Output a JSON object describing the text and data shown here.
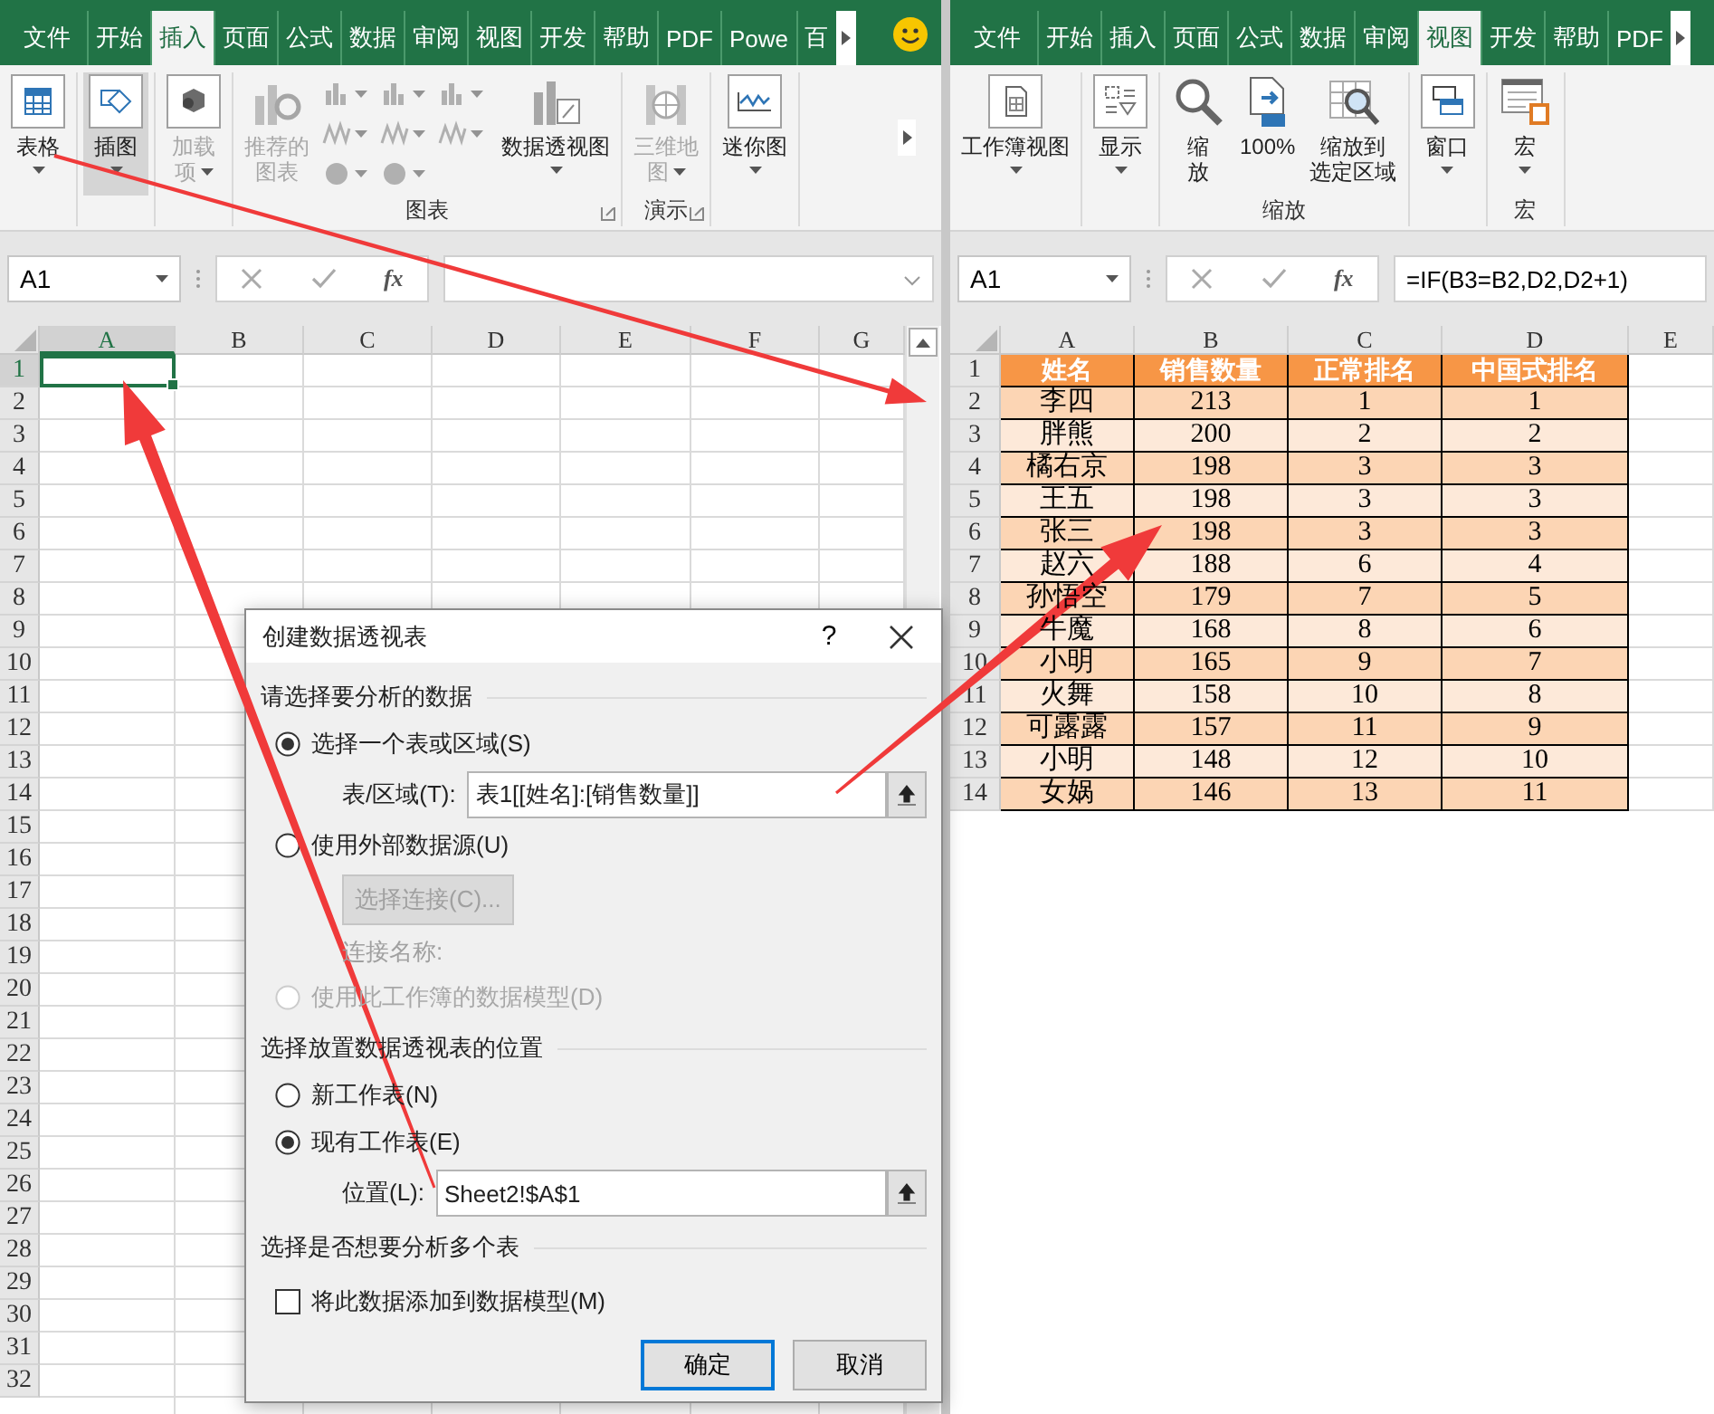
{
  "left_pane": {
    "tabs": [
      {
        "label": "文件",
        "selected": false
      },
      {
        "label": "开始",
        "selected": false
      },
      {
        "label": "插入",
        "selected": true
      },
      {
        "label": "页面",
        "selected": false
      },
      {
        "label": "公式",
        "selected": false
      },
      {
        "label": "数据",
        "selected": false
      },
      {
        "label": "审阅",
        "selected": false
      },
      {
        "label": "视图",
        "selected": false
      },
      {
        "label": "开发",
        "selected": false
      },
      {
        "label": "帮助",
        "selected": false
      },
      {
        "label": "PDF",
        "selected": false
      },
      {
        "label": "Powe",
        "selected": false
      },
      {
        "label": "百",
        "selected": false
      }
    ],
    "ribbon": {
      "groups": [
        {
          "items": [
            {
              "kind": "big",
              "lines": [
                "表格"
              ],
              "dropdown": true,
              "disabled": false,
              "pressed": false
            }
          ]
        },
        {
          "items": [
            {
              "kind": "big",
              "lines": [
                "插图"
              ],
              "dropdown": true,
              "disabled": false,
              "pressed": true
            }
          ]
        },
        {
          "items": [
            {
              "kind": "big",
              "lines": [
                "加载",
                "项"
              ],
              "dropdown": true,
              "disabled": true,
              "pressed": false
            }
          ]
        },
        {
          "label": "图表",
          "items": [
            {
              "kind": "big",
              "lines": [
                "推荐的",
                "图表"
              ],
              "dropdown": false,
              "disabled": true,
              "pressed": false
            },
            {
              "kind": "gallery",
              "dropdown": true,
              "disabled": true,
              "pressed": false
            },
            {
              "kind": "big",
              "lines": [
                "数据透视图"
              ],
              "dropdown": true,
              "disabled": false,
              "pressed": false
            }
          ]
        },
        {
          "label": "演示",
          "items": [
            {
              "kind": "big",
              "lines": [
                "三维地",
                "图"
              ],
              "dropdown": true,
              "disabled": true,
              "pressed": false
            }
          ]
        },
        {
          "items": [
            {
              "kind": "big",
              "lines": [
                "迷你图"
              ],
              "dropdown": true,
              "disabled": false,
              "pressed": false
            }
          ]
        }
      ]
    },
    "formula_bar": {
      "name_box": "A1",
      "function_label": "fx"
    },
    "grid": {
      "columns": [
        {
          "label": "A",
          "selected": true
        },
        {
          "label": "B",
          "selected": false
        },
        {
          "label": "C",
          "selected": false
        },
        {
          "label": "D",
          "selected": false
        },
        {
          "label": "E",
          "selected": false
        },
        {
          "label": "F",
          "selected": false
        },
        {
          "label": "G",
          "selected": false
        }
      ],
      "rows": [
        {
          "label": "1",
          "selected": true
        },
        {
          "label": "2",
          "selected": false
        },
        {
          "label": "3",
          "selected": false
        },
        {
          "label": "4",
          "selected": false
        },
        {
          "label": "5",
          "selected": false
        },
        {
          "label": "6",
          "selected": false
        },
        {
          "label": "7",
          "selected": false
        },
        {
          "label": "8",
          "selected": false
        },
        {
          "label": "9",
          "selected": false
        },
        {
          "label": "10",
          "selected": false
        },
        {
          "label": "11",
          "selected": false
        },
        {
          "label": "12",
          "selected": false
        },
        {
          "label": "13",
          "selected": false
        },
        {
          "label": "14",
          "selected": false
        },
        {
          "label": "15",
          "selected": false
        },
        {
          "label": "16",
          "selected": false
        },
        {
          "label": "17",
          "selected": false
        },
        {
          "label": "18",
          "selected": false
        },
        {
          "label": "19",
          "selected": false
        },
        {
          "label": "20",
          "selected": false
        },
        {
          "label": "21",
          "selected": false
        },
        {
          "label": "22",
          "selected": false
        },
        {
          "label": "23",
          "selected": false
        },
        {
          "label": "24",
          "selected": false
        },
        {
          "label": "25",
          "selected": false
        },
        {
          "label": "26",
          "selected": false
        },
        {
          "label": "27",
          "selected": false
        },
        {
          "label": "28",
          "selected": false
        },
        {
          "label": "29",
          "selected": false
        },
        {
          "label": "30",
          "selected": false
        },
        {
          "label": "31",
          "selected": false
        },
        {
          "label": "32",
          "selected": false
        }
      ]
    }
  },
  "right_pane": {
    "tabs": [
      {
        "label": "文件",
        "selected": false
      },
      {
        "label": "开始",
        "selected": false
      },
      {
        "label": "插入",
        "selected": false
      },
      {
        "label": "页面",
        "selected": false
      },
      {
        "label": "公式",
        "selected": false
      },
      {
        "label": "数据",
        "selected": false
      },
      {
        "label": "审阅",
        "selected": false
      },
      {
        "label": "视图",
        "selected": true
      },
      {
        "label": "开发",
        "selected": false
      },
      {
        "label": "帮助",
        "selected": false
      },
      {
        "label": "PDF",
        "selected": false
      }
    ],
    "ribbon": {
      "groups": [
        {
          "items": [
            {
              "kind": "big",
              "lines": [
                "工作簿视图"
              ],
              "dropdown": true,
              "disabled": false,
              "pressed": false
            }
          ]
        },
        {
          "items": [
            {
              "kind": "big",
              "lines": [
                "显示"
              ],
              "dropdown": true,
              "disabled": false,
              "pressed": false
            }
          ]
        },
        {
          "label": "缩放",
          "items": [
            {
              "kind": "big",
              "lines": [
                "缩",
                "放"
              ],
              "dropdown": false,
              "disabled": false,
              "pressed": false
            },
            {
              "kind": "big",
              "lines": [
                "100%"
              ],
              "dropdown": false,
              "disabled": false,
              "pressed": false
            },
            {
              "kind": "big",
              "lines": [
                "缩放到",
                "选定区域"
              ],
              "dropdown": false,
              "disabled": false,
              "pressed": false
            }
          ]
        },
        {
          "items": [
            {
              "kind": "big",
              "lines": [
                "窗口"
              ],
              "dropdown": true,
              "disabled": false,
              "pressed": false
            }
          ]
        },
        {
          "label": "宏",
          "items": [
            {
              "kind": "big",
              "lines": [
                "宏"
              ],
              "dropdown": true,
              "disabled": false,
              "pressed": false
            }
          ]
        }
      ]
    },
    "formula_bar": {
      "name_box": "A1",
      "function_label": "fx",
      "formula": "=IF(B3=B2,D2,D2+1)"
    },
    "grid": {
      "columns": [
        {
          "label": "A",
          "selected": false
        },
        {
          "label": "B",
          "selected": false
        },
        {
          "label": "C",
          "selected": false
        },
        {
          "label": "D",
          "selected": false
        },
        {
          "label": "E",
          "selected": false
        }
      ],
      "rows": [
        {
          "label": "1",
          "selected": false
        },
        {
          "label": "2",
          "selected": false
        },
        {
          "label": "3",
          "selected": false
        },
        {
          "label": "4",
          "selected": false
        },
        {
          "label": "5",
          "selected": false
        },
        {
          "label": "6",
          "selected": false
        },
        {
          "label": "7",
          "selected": false
        },
        {
          "label": "8",
          "selected": false
        },
        {
          "label": "9",
          "selected": false
        },
        {
          "label": "10",
          "selected": false
        },
        {
          "label": "11",
          "selected": false
        },
        {
          "label": "12",
          "selected": false
        },
        {
          "label": "13",
          "selected": false
        },
        {
          "label": "14",
          "selected": false
        }
      ]
    },
    "table": {
      "header": [
        "姓名",
        "销售数量",
        "正常排名",
        "中国式排名"
      ],
      "rows": [
        [
          "李四",
          "213",
          "1",
          "1"
        ],
        [
          "胖熊",
          "200",
          "2",
          "2"
        ],
        [
          "橘右京",
          "198",
          "3",
          "3"
        ],
        [
          "王五",
          "198",
          "3",
          "3"
        ],
        [
          "张三",
          "198",
          "3",
          "3"
        ],
        [
          "赵六",
          "188",
          "6",
          "4"
        ],
        [
          "孙悟空",
          "179",
          "7",
          "5"
        ],
        [
          "牛魔",
          "168",
          "8",
          "6"
        ],
        [
          "小明",
          "165",
          "9",
          "7"
        ],
        [
          "火舞",
          "158",
          "10",
          "8"
        ],
        [
          "可露露",
          "157",
          "11",
          "9"
        ],
        [
          "小明",
          "148",
          "12",
          "10"
        ],
        [
          "女娲",
          "146",
          "13",
          "11"
        ]
      ]
    }
  },
  "dialog": {
    "title": "创建数据透视表",
    "help_label": "?",
    "source_heading": "请选择要分析的数据",
    "source_options": [
      {
        "label": "选择一个表或区域(S)",
        "selected": true,
        "disabled": false
      },
      {
        "label": "使用外部数据源(U)",
        "selected": false,
        "disabled": false
      },
      {
        "label": "使用此工作簿的数据模型(D)",
        "selected": false,
        "disabled": true
      }
    ],
    "range_label": "表/区域(T):",
    "range_value": "表1[[姓名]:[销售数量]]",
    "connection_button": {
      "label": "选择连接(C)...",
      "disabled": true
    },
    "connection_name": {
      "label": "连接名称:",
      "disabled": true
    },
    "placement_heading": "选择放置数据透视表的位置",
    "placement_options": [
      {
        "label": "新工作表(N)",
        "selected": false
      },
      {
        "label": "现有工作表(E)",
        "selected": true
      }
    ],
    "location_label": "位置(L):",
    "location_value": "Sheet2!$A$1",
    "multi_heading": "选择是否想要分析多个表",
    "data_model_checkbox": {
      "label": "将此数据添加到数据模型(M)",
      "checked": false
    },
    "buttons": [
      {
        "label": "确定",
        "default": true
      },
      {
        "label": "取消",
        "default": false
      }
    ]
  }
}
